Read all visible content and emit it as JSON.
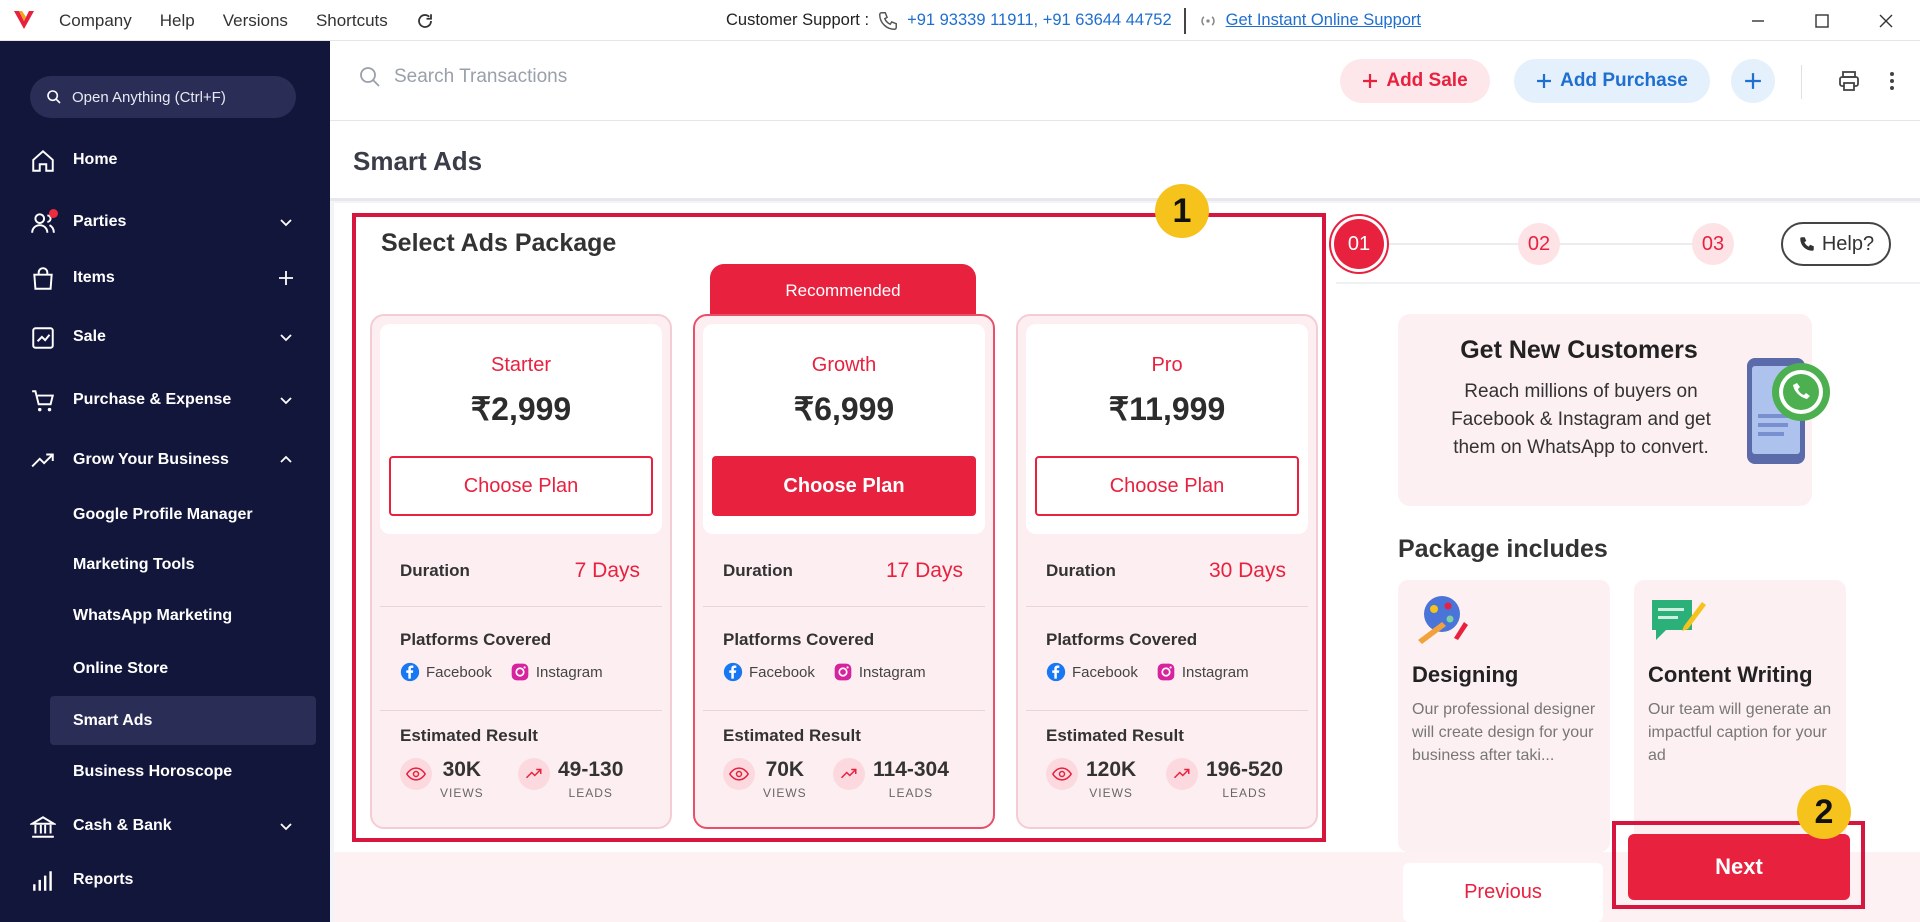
{
  "titlebar": {
    "menu": [
      "Company",
      "Help",
      "Versions",
      "Shortcuts"
    ],
    "support_label": "Customer Support :",
    "support_phones": "+91 93339 11911, +91 63644 44752",
    "online_support": "Get Instant Online Support"
  },
  "sidebar": {
    "search": "Open Anything (Ctrl+F)",
    "items": {
      "home": "Home",
      "parties": "Parties",
      "items": "Items",
      "sale": "Sale",
      "purchase": "Purchase & Expense",
      "grow": "Grow Your Business",
      "cash": "Cash & Bank",
      "reports": "Reports"
    },
    "sub": {
      "google": "Google Profile Manager",
      "marketing": "Marketing Tools",
      "whatsapp": "WhatsApp Marketing",
      "store": "Online Store",
      "smart_ads": "Smart Ads",
      "horoscope": "Business Horoscope"
    }
  },
  "topbar": {
    "search_placeholder": "Search Transactions",
    "add_sale": "Add Sale",
    "add_purchase": "Add Purchase"
  },
  "page": {
    "title": "Smart Ads"
  },
  "package": {
    "title": "Select Ads Package",
    "recommended": "Recommended",
    "choose_label": "Choose Plan",
    "duration_label": "Duration",
    "platforms_label": "Platforms Covered",
    "facebook": "Facebook",
    "instagram": "Instagram",
    "estimated_label": "Estimated Result",
    "views_label": "VIEWS",
    "leads_label": "LEADS",
    "plans": [
      {
        "name": "Starter",
        "price": "₹2,999",
        "duration": "7 Days",
        "views": "30K",
        "leads": "49-130"
      },
      {
        "name": "Growth",
        "price": "₹6,999",
        "duration": "17 Days",
        "views": "70K",
        "leads": "114-304"
      },
      {
        "name": "Pro",
        "price": "₹11,999",
        "duration": "30 Days",
        "views": "120K",
        "leads": "196-520"
      }
    ]
  },
  "steps": [
    "01",
    "02",
    "03"
  ],
  "help": "Help?",
  "promo": {
    "title": "Get New Customers",
    "text": "Reach millions of buyers on Facebook & Instagram and get them on WhatsApp to convert."
  },
  "includes": {
    "title": "Package includes",
    "cards": [
      {
        "title": "Designing",
        "desc": "Our professional designer will create design for your business after taki..."
      },
      {
        "title": "Content Writing",
        "desc": "Our team will generate an impactful caption for your ad"
      }
    ]
  },
  "buttons": {
    "previous": "Previous",
    "next": "Next"
  },
  "annotations": [
    "1",
    "2"
  ],
  "colors": {
    "accent": "#e8213f",
    "sidebar": "#13163b",
    "annotation": "#d6163f",
    "badge": "#f6c21c",
    "link": "#1f6fd0"
  }
}
